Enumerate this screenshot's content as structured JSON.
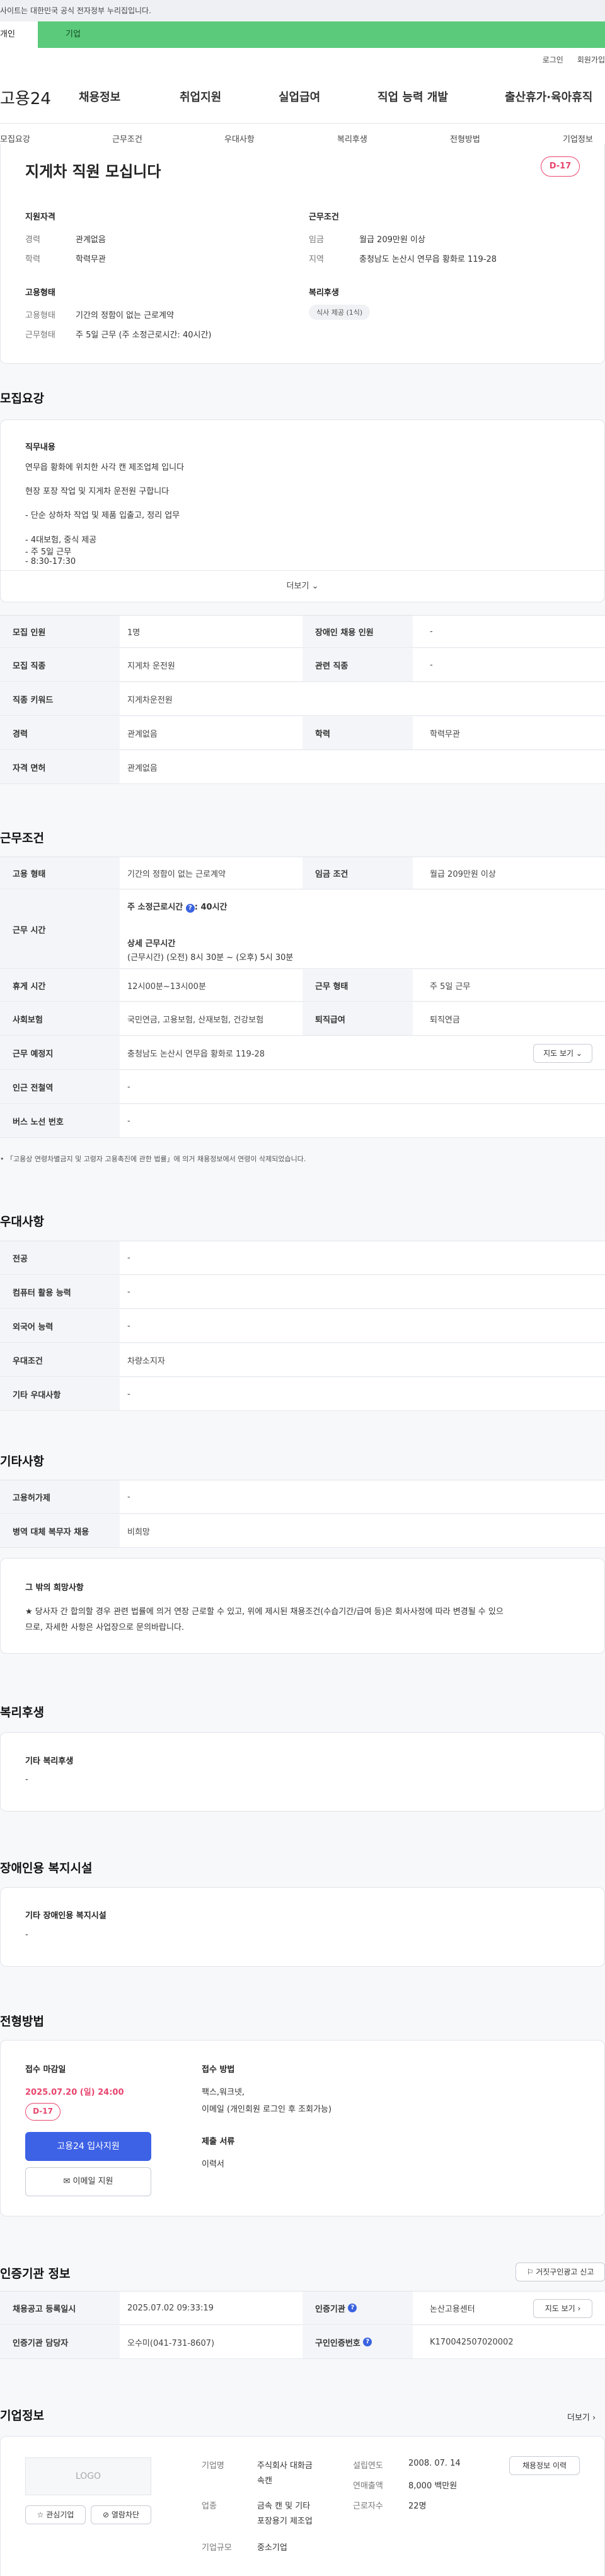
{
  "topbar": {
    "notice": "사이트는 대한민국 공식 전자정부 누리집입니다."
  },
  "tabs": {
    "left": "개인",
    "right": "기업"
  },
  "util": {
    "login": "로그인",
    "join": "회원가입"
  },
  "logo": "고용24",
  "gnb": [
    "채용정보",
    "취업지원",
    "실업급여",
    "직업 능력 개발",
    "출산휴가·육아휴직"
  ],
  "subnav": [
    "모집요강",
    "근무조건",
    "우대사항",
    "복리후생",
    "전형방법",
    "기업정보"
  ],
  "summary": {
    "title": "지게차 직원 모십니다",
    "dday": "D-17",
    "qual_label": "지원자격",
    "career_k": "경력",
    "career_v": "관계없음",
    "edu_k": "학력",
    "edu_v": "학력무관",
    "cond_label": "근무조건",
    "wage_k": "임금",
    "wage_v": "월급 209만원 이상",
    "region_k": "지역",
    "region_v": "충청남도 논산시 연무읍 황화로 119-28",
    "emp_label": "고용형태",
    "emptype_k": "고용형태",
    "emptype_v": "기간의 정함이 없는 근로계약",
    "worktype_k": "근무형태",
    "worktype_v": "주 5일 근무 (주 소정근로시간: 40시간)",
    "welfare_label": "복리후생",
    "welfare_chip": "식사 제공 (1식)"
  },
  "recruit": {
    "section": "모집요강",
    "duty_label": "직무내용",
    "lines": [
      "연무읍 황화에 위치한 사각 캔 제조업체 입니다",
      "현장 포장 작업 및 지게차 운전원 구합니다",
      "- 단순 상하차 작업 및 제품 입출고, 정리 업무",
      "- 4대보험, 중식 제공",
      "- 주 5일 근무",
      "- 8:30-17:30"
    ],
    "more": "더보기",
    "count_h": "모집 인원",
    "count_v": "1명",
    "disab_h": "장애인 채용 인원",
    "disab_v": "-",
    "job_h": "모집 직종",
    "job_v": "지게차 운전원",
    "rel_h": "관련 직종",
    "rel_v": "-",
    "kw_h": "직종 키워드",
    "kw_v": "지게차운전원",
    "career_h": "경력",
    "career_v": "관계없음",
    "edu_h": "학력",
    "edu_v": "학력무관",
    "lic_h": "자격 면허",
    "lic_v": "관계없음"
  },
  "cond": {
    "section": "근무조건",
    "emptype_h": "고용 형태",
    "emptype_v": "기간의 정함이 없는 근로계약",
    "wage_h": "임금 조건",
    "wage_v": "월급 209만원 이상",
    "hours_h": "근무 시간",
    "hours_v1": "주 소정근로시간",
    "hours_v1b": ": 40시간",
    "hours_v2": "상세 근무시간",
    "hours_v3": "(근무시간) (오전) 8시 30분 ~ (오후) 5시 30분",
    "break_h": "휴게 시간",
    "break_v": "12시00분~13시00분",
    "wtype_h": "근무 형태",
    "wtype_v": "주 5일 근무",
    "ins_h": "사회보험",
    "ins_v": "국민연금, 고용보험, 산재보험, 건강보험",
    "ret_h": "퇴직급여",
    "ret_v": "퇴직연금",
    "loc_h": "근무 예정지",
    "loc_v": "충청남도 논산시 연무읍 황화로 119-28",
    "map_btn": "지도 보기",
    "sub_h": "인근 전철역",
    "sub_v": "-",
    "bus_h": "버스 노선 번호",
    "bus_v": "-",
    "footnote": "「고용상 연령차별금지 및 고령자 고용촉진에 관한 법률」에 의거 채용정보에서 연령이 삭제되었습니다."
  },
  "pref": {
    "section": "우대사항",
    "major_h": "전공",
    "major_v": "-",
    "pc_h": "컴퓨터 활용 능력",
    "pc_v": "-",
    "lang_h": "외국어 능력",
    "lang_v": "-",
    "cond_h": "우대조건",
    "cond_v": "차량소지자",
    "etc_h": "기타 우대사항",
    "etc_v": "-"
  },
  "etc": {
    "section": "기타사항",
    "disab_h": "고용허가제",
    "disab_v": "-",
    "mil_h": "병역 대체 복무자 채용",
    "mil_v": "비희망",
    "other_label": "그 밖의 희망사항",
    "other_text1": "★ 당사자 간 합의할 경우 관련 법률에 의거 연장 근로할 수 있고, 위에 제시된 채용조건(수습기간/급여 등)은 회사사정에 따라 변경될 수 있으",
    "other_text2": "므로, 자세한 사항은 사업장으로 문의바랍니다."
  },
  "welfare": {
    "section": "복리후생",
    "label": "기타 복리후생",
    "value": "-"
  },
  "facility": {
    "section": "장애인용 복지시설",
    "label": "기타 장애인용 복지시설",
    "value": "-"
  },
  "process": {
    "section": "전형방법",
    "deadline_label": "접수 마감일",
    "deadline": "2025.07.20 (일) 24:00",
    "dday": "D-17",
    "apply_btn": "고용24 입사지원",
    "email_btn": "이메일 지원",
    "method_label": "접수 방법",
    "method_v1": "팩스,워크넷,",
    "method_v2": "이메일 (개인회원 로그인 후 조회가능)",
    "docs_label": "제출 서류",
    "docs_v": "이력서"
  },
  "cert": {
    "section": "인증기관 정보",
    "report_btn": "거짓구인광고 신고",
    "reg_h": "채용공고 등록일시",
    "reg_v": "2025.07.02 09:33:19",
    "org_h": "인증기관",
    "org_v": "논산고용센터",
    "map_btn": "지도 보기",
    "mgr_h": "인증기관 담당자",
    "mgr_v": "오수미(041-731-8607)",
    "no_h": "구인인증번호",
    "no_v": "K170042507020002"
  },
  "company": {
    "section": "기업정보",
    "more": "더보기",
    "logo": "LOGO",
    "fav_btn": "관심기업",
    "block_btn": "열람차단",
    "name_k": "기업명",
    "name_v1": "주식회사 대화금",
    "name_v2": "속캔",
    "ind_k": "업종",
    "ind_v1": "금속 캔 및 기타",
    "ind_v2": "포장용기 제조업",
    "size_k": "기업규모",
    "size_v": "중소기업",
    "found_k": "설립연도",
    "found_v": "2008. 07. 14",
    "sales_k": "연매출액",
    "sales_v": "8,000 백만원",
    "emp_k": "근로자수",
    "emp_v": "22명",
    "hist_btn": "채용정보 이력"
  }
}
